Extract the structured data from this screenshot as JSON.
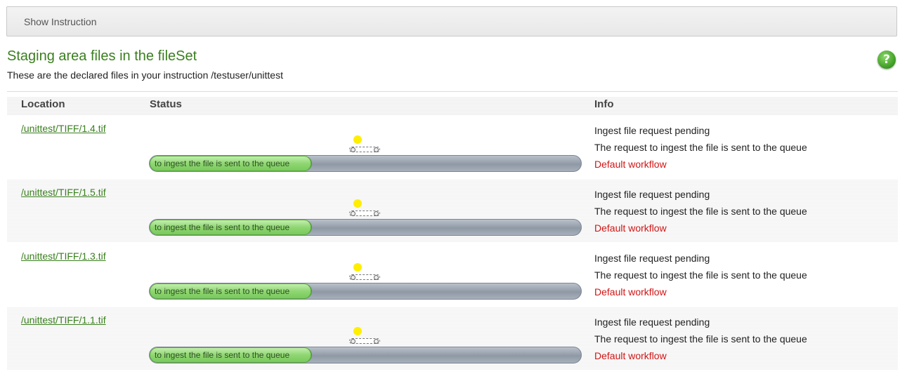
{
  "instruction_bar": {
    "label": "Show Instruction"
  },
  "header": {
    "title": "Staging area files in the fileSet",
    "subtitle": "These are the declared files in your instruction  /testuser/unittest"
  },
  "help": {
    "glyph": "?"
  },
  "table": {
    "columns": [
      "Location",
      "Status",
      "Info"
    ],
    "rows": [
      {
        "location": "/unittest/TIFF/1.4.tif",
        "progress_text": "to ingest the file is sent to the queue",
        "progress_fraction": 0.375,
        "info_status": "Ingest file request pending",
        "info_message": "The request to ingest the file is sent to the queue",
        "workflow": "Default workflow"
      },
      {
        "location": "/unittest/TIFF/1.5.tif",
        "progress_text": "to ingest the file is sent to the queue",
        "progress_fraction": 0.375,
        "info_status": "Ingest file request pending",
        "info_message": "The request to ingest the file is sent to the queue",
        "workflow": "Default workflow"
      },
      {
        "location": "/unittest/TIFF/1.3.tif",
        "progress_text": "to ingest the file is sent to the queue",
        "progress_fraction": 0.375,
        "info_status": "Ingest file request pending",
        "info_message": "The request to ingest the file is sent to the queue",
        "workflow": "Default workflow"
      },
      {
        "location": "/unittest/TIFF/1.1.tif",
        "progress_text": "to ingest the file is sent to the queue",
        "progress_fraction": 0.375,
        "info_status": "Ingest file request pending",
        "info_message": "The request to ingest the file is sent to the queue",
        "workflow": "Default workflow"
      }
    ]
  },
  "colors": {
    "title_green": "#3a7f1e",
    "link_green": "#3a7f1e",
    "workflow_red": "#d21414",
    "indicator_yellow": "#ffee00"
  },
  "icons": {
    "help": "help-icon",
    "activity": "activity-indicator-icon",
    "conveyor": "queue-conveyor-icon"
  }
}
